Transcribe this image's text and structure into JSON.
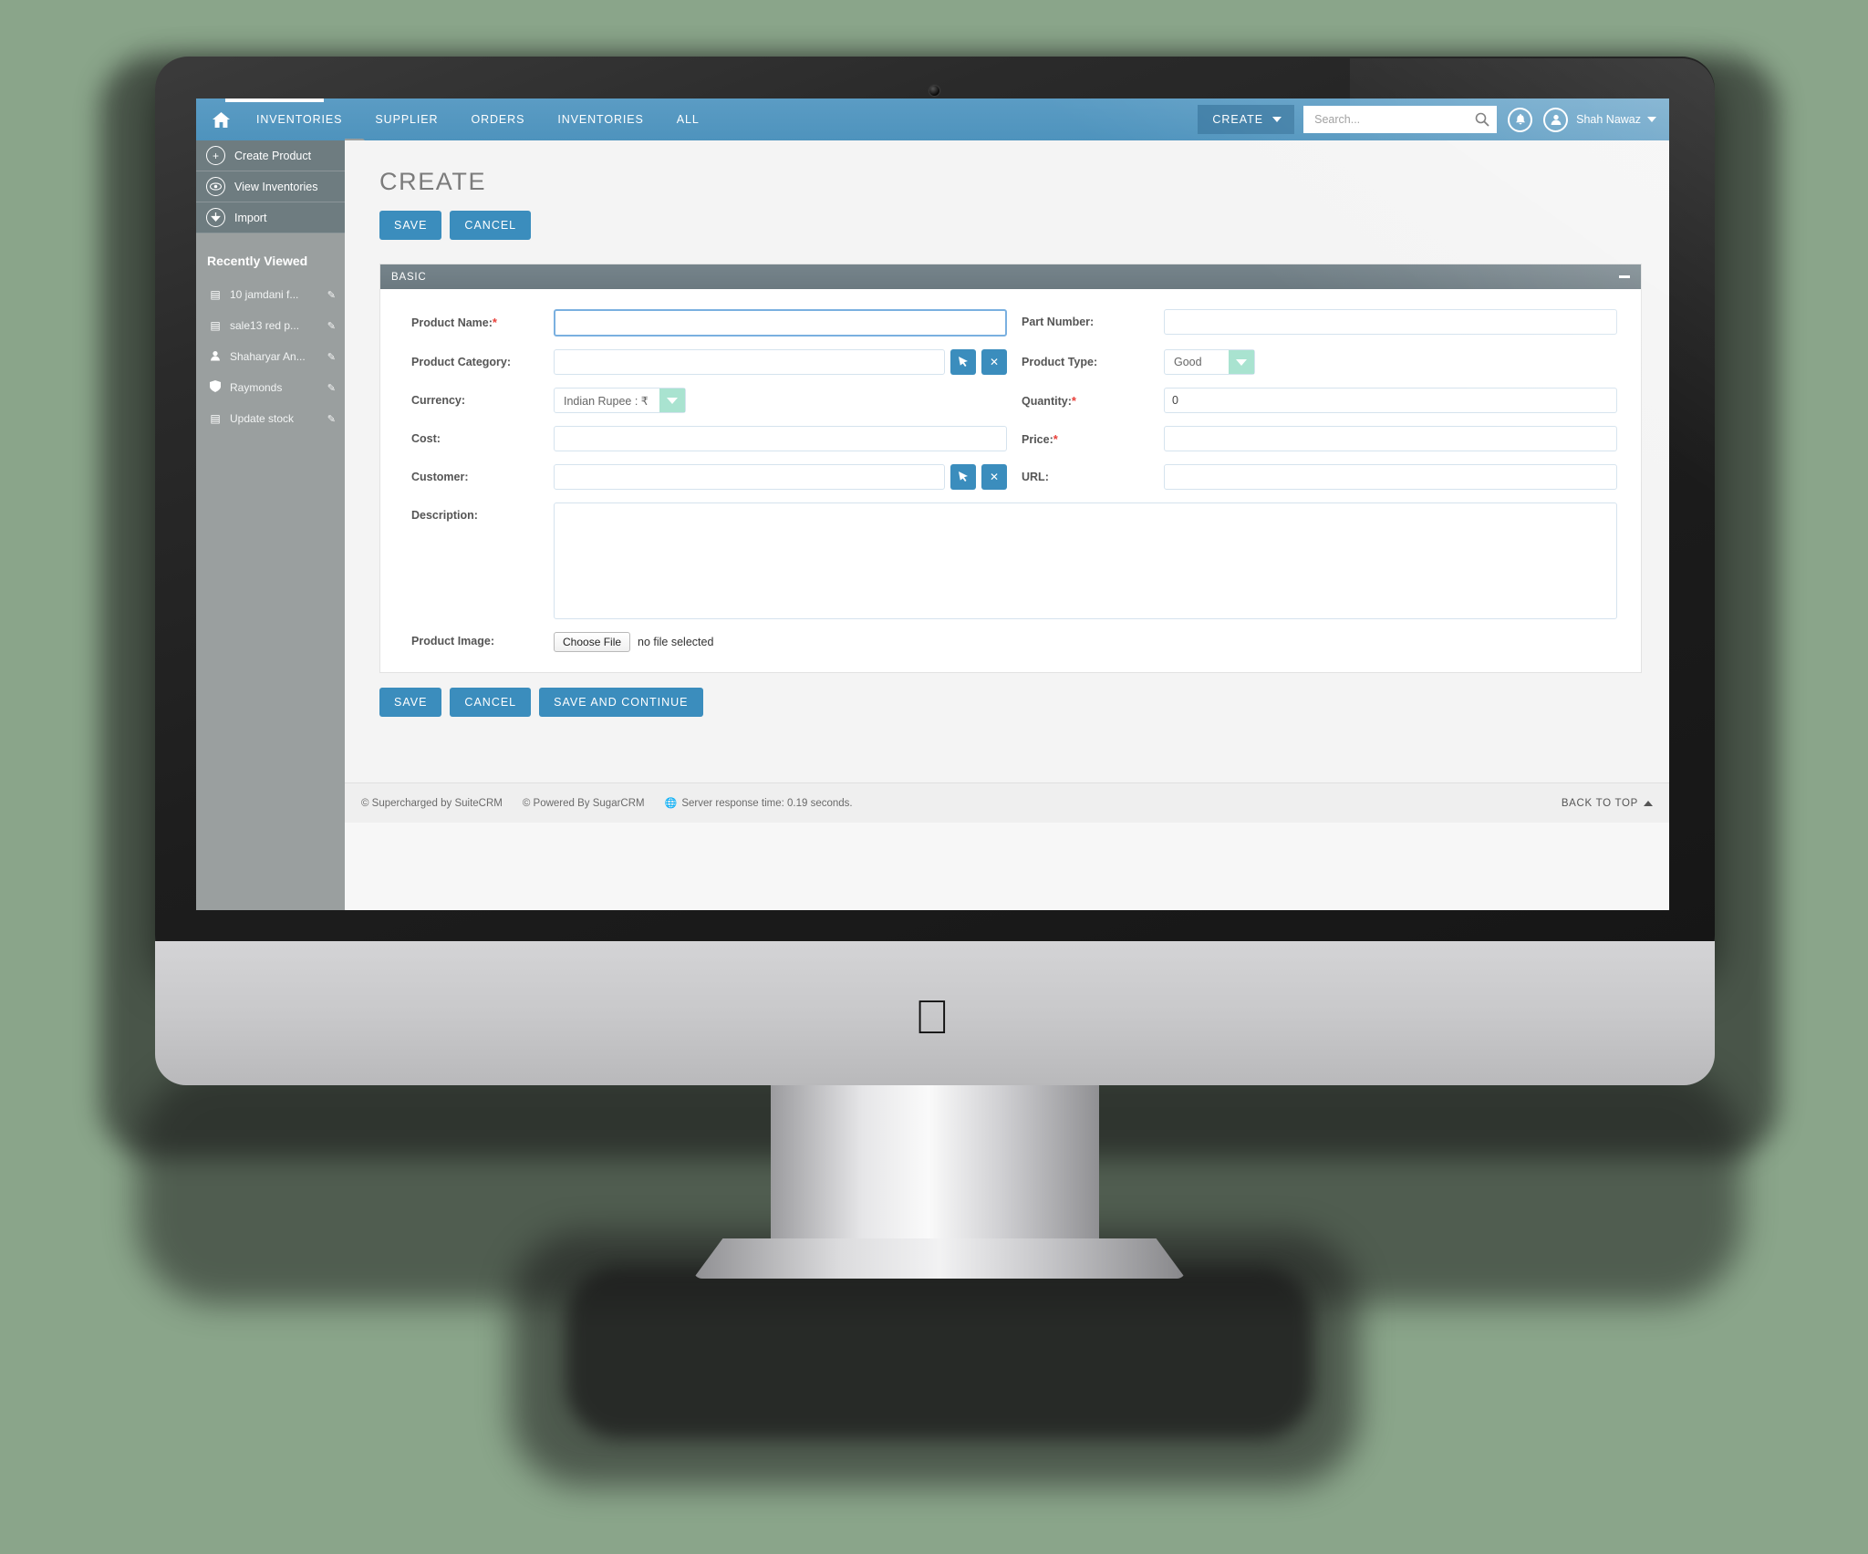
{
  "navbar": {
    "home_icon": "home-icon",
    "items": [
      {
        "label": "INVENTORIES"
      },
      {
        "label": "SUPPLIER"
      },
      {
        "label": "ORDERS"
      },
      {
        "label": "INVENTORIES"
      },
      {
        "label": "ALL"
      }
    ],
    "create_label": "CREATE",
    "search_placeholder": "Search...",
    "search_value": "",
    "notification_icon": "bell-icon",
    "avatar_icon": "user-avatar-icon",
    "user_name": "Shah Nawaz",
    "accent_color": "#4e93bd"
  },
  "sidebar": {
    "actions": [
      {
        "label": "Create Product",
        "icon": "plus-circle-icon"
      },
      {
        "label": "View Inventories",
        "icon": "eye-icon"
      },
      {
        "label": "Import",
        "icon": "download-arrow-icon"
      }
    ],
    "recent_title": "Recently Viewed",
    "recent": [
      {
        "label": "10 jamdani f...",
        "icon": "document-icon"
      },
      {
        "label": "sale13 red p...",
        "icon": "document-icon"
      },
      {
        "label": "Shaharyar An...",
        "icon": "person-icon"
      },
      {
        "label": "Raymonds",
        "icon": "shield-icon"
      },
      {
        "label": "Update stock",
        "icon": "document-icon"
      }
    ],
    "collapse_icon": "chevron-left-icon"
  },
  "main": {
    "title": "CREATE",
    "top_buttons": [
      {
        "label": "SAVE"
      },
      {
        "label": "CANCEL"
      }
    ],
    "panel": {
      "title": "BASIC",
      "collapse_icon": "minus-icon"
    },
    "fields": {
      "product_name": {
        "label": "Product Name:",
        "required": true,
        "value": ""
      },
      "part_number": {
        "label": "Part Number:",
        "required": false,
        "value": ""
      },
      "product_category": {
        "label": "Product Category:",
        "required": false,
        "value": "",
        "select_icon": "arrow-select-icon",
        "clear_icon": "clear-x-icon"
      },
      "product_type": {
        "label": "Product Type:",
        "required": false,
        "value": "Good"
      },
      "currency": {
        "label": "Currency:",
        "required": false,
        "value": "Indian Rupee : ₹"
      },
      "quantity": {
        "label": "Quantity:",
        "required": true,
        "value": "0"
      },
      "cost": {
        "label": "Cost:",
        "required": false,
        "value": ""
      },
      "price": {
        "label": "Price:",
        "required": true,
        "value": ""
      },
      "customer": {
        "label": "Customer:",
        "required": false,
        "value": "",
        "select_icon": "arrow-select-icon",
        "clear_icon": "clear-x-icon"
      },
      "url": {
        "label": "URL:",
        "required": false,
        "value": ""
      },
      "description": {
        "label": "Description:",
        "required": false,
        "value": ""
      },
      "product_image": {
        "label": "Product Image:",
        "choose_label": "Choose File",
        "status": "no file selected"
      }
    },
    "bottom_buttons": [
      {
        "label": "SAVE"
      },
      {
        "label": "CANCEL"
      },
      {
        "label": "SAVE AND CONTINUE"
      }
    ]
  },
  "footer": {
    "supercharged": "© Supercharged by SuiteCRM",
    "powered": "© Powered By SugarCRM",
    "server_time": "Server response time: 0.19 seconds.",
    "back_to_top": "BACK TO TOP"
  }
}
